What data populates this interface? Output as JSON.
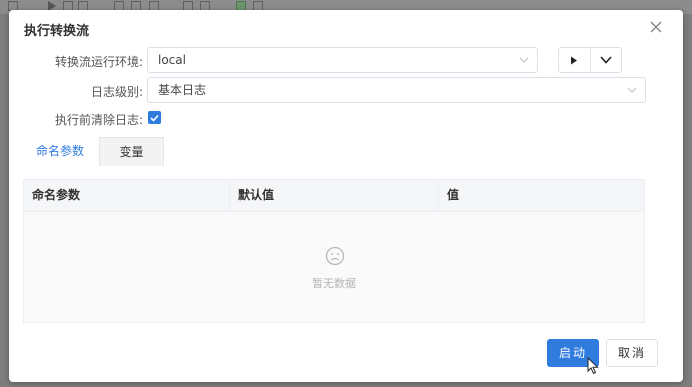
{
  "dialog": {
    "title": "执行转换流"
  },
  "form": {
    "env_label": "转换流运行环境:",
    "env_value": "local",
    "log_label": "日志级别:",
    "log_value": "基本日志",
    "clear_log_label": "执行前清除日志:",
    "clear_log_checked": true
  },
  "tabs": [
    {
      "label": "命名参数",
      "active": true
    },
    {
      "label": "变量",
      "active": false
    }
  ],
  "table": {
    "columns": [
      "命名参数",
      "默认值",
      "值"
    ],
    "empty_text": "暂无数据"
  },
  "footer": {
    "start_label": "启动",
    "cancel_label": "取消"
  },
  "colors": {
    "accent": "#2f7bde",
    "border": "#dcdfe6"
  },
  "icons": [
    "close-icon",
    "play-icon",
    "chevron-down-icon",
    "check-icon",
    "sad-face-icon",
    "cursor-icon"
  ]
}
